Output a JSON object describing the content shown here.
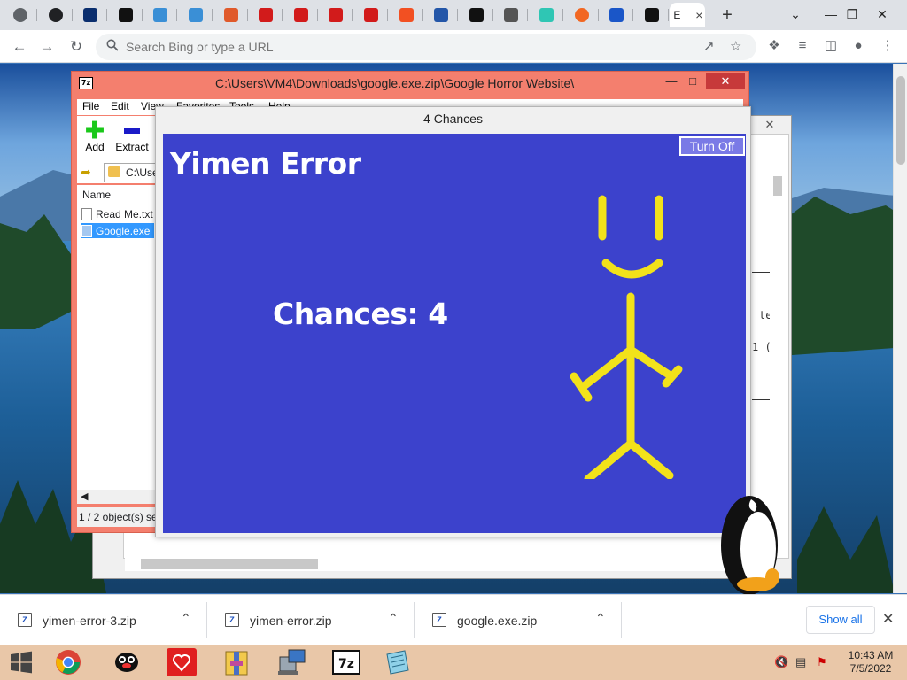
{
  "browser": {
    "address": {
      "placeholder": "Search Bing or type a URL"
    },
    "tabs": [
      {
        "icon": "globe-icon",
        "color": "#5f6368"
      },
      {
        "icon": "globe-icon",
        "color": "#202124"
      },
      {
        "icon": "q-square-icon",
        "color": "#0a2e6e"
      },
      {
        "icon": "museum-icon",
        "color": "#111111"
      },
      {
        "icon": "edge-icon",
        "color": "#3a8fd6"
      },
      {
        "icon": "edge-icon",
        "color": "#3a8fd6"
      },
      {
        "icon": "rainbow-icon",
        "color": "#e05a2b"
      },
      {
        "icon": "adobe-icon",
        "color": "#d21b1b"
      },
      {
        "icon": "adobe-icon",
        "color": "#d21b1b"
      },
      {
        "icon": "adobe-icon",
        "color": "#d21b1b"
      },
      {
        "icon": "adobe-icon",
        "color": "#d21b1b"
      },
      {
        "icon": "microsoft-icon",
        "color": "#f25022"
      },
      {
        "icon": "database-icon",
        "color": "#2356a8"
      },
      {
        "icon": "slash-icon",
        "color": "#111111"
      },
      {
        "icon": "audio-icon",
        "color": "#555555"
      },
      {
        "icon": "teal-logo-icon",
        "color": "#2fc6b4"
      },
      {
        "icon": "orange-circle-icon",
        "color": "#f26722"
      },
      {
        "icon": "search-icon",
        "color": "#1a56c8"
      },
      {
        "icon": "slash-icon",
        "color": "#111111"
      }
    ],
    "active_tab_label": "E"
  },
  "zip_window": {
    "title": "C:\\Users\\VM4\\Downloads\\google.exe.zip\\Google Horror Website\\",
    "menu": [
      "File",
      "Edit",
      "View",
      "Favorites",
      "Tools",
      "Help"
    ],
    "tools": [
      {
        "label": "Add"
      },
      {
        "label": "Extract"
      }
    ],
    "path": "C:\\Use",
    "column_header": "Name",
    "files": [
      {
        "name": "Read Me.txt",
        "selected": false
      },
      {
        "name": "Google.exe",
        "selected": true
      }
    ],
    "status": "1 / 2 object(s) se"
  },
  "back_window": {
    "snippets": [
      "te",
      "1 ("
    ]
  },
  "chances_window": {
    "title": "4 Chances",
    "turn_off_label": "Turn Off",
    "heading": "Yimen Error",
    "chances_label": "Chances: 4",
    "canvas_color": "#3c42cc",
    "figure_color": "#f2e21a"
  },
  "downloads": {
    "items": [
      {
        "name": "yimen-error-3.zip"
      },
      {
        "name": "yimen-error.zip"
      },
      {
        "name": "google.exe.zip"
      }
    ],
    "show_all_label": "Show all"
  },
  "taskbar": {
    "apps": [
      "windows-start-icon",
      "chrome-icon",
      "penguin-icon",
      "heart-logo-icon",
      "archive-icon",
      "network-computer-icon",
      "7zip-icon",
      "notepad-icon"
    ],
    "time": "10:43 AM",
    "date": "7/5/2022"
  }
}
